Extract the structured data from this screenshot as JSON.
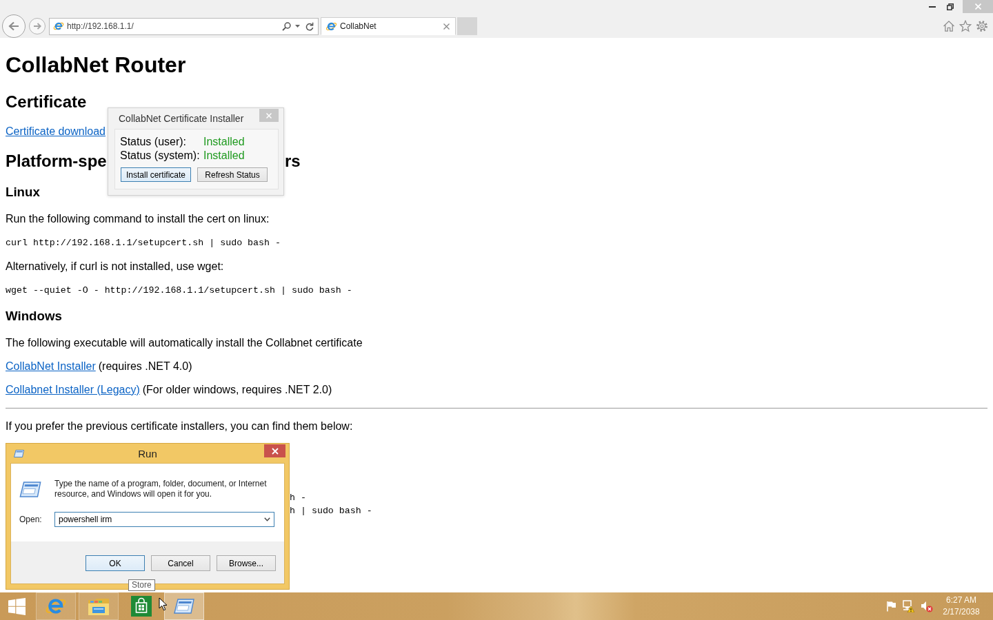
{
  "browser": {
    "address": "http://192.168.1.1/",
    "tabs": [
      {
        "label": "CollabNet",
        "selected": true
      }
    ]
  },
  "page": {
    "blocks": [
      {
        "kind": "title",
        "text": "CollabNet Router"
      },
      {
        "kind": "heading",
        "text": "Certificate"
      },
      {
        "kind": "link_line",
        "link": "Certificate download"
      },
      {
        "kind": "obscured_heading",
        "fragments": [
          "Platform-spe",
          "rs"
        ]
      },
      {
        "kind": "subheading",
        "text": "Linux"
      },
      {
        "kind": "paragraph",
        "text": "Run the following command to install the cert on linux:"
      },
      {
        "kind": "code",
        "text": "curl http://192.168.1.1/setupcert.sh | sudo bash -"
      },
      {
        "kind": "paragraph",
        "text": "Alternatively, if curl is not installed, use wget:"
      },
      {
        "kind": "code",
        "text": "wget --quiet -O - http://192.168.1.1/setupcert.sh | sudo bash -"
      },
      {
        "kind": "subheading",
        "text": "Windows"
      },
      {
        "kind": "paragraph",
        "text": "The following executable will automatically install the Collabnet certificate"
      },
      {
        "kind": "link_line",
        "link": "CollabNet Installer",
        "note": "(requires .NET 4.0)"
      },
      {
        "kind": "link_line",
        "link": "Collabnet Installer (Legacy)",
        "note": "(For older windows, requires .NET 2.0)"
      },
      {
        "kind": "rule"
      },
      {
        "kind": "paragraph",
        "text": "If you prefer the previous certificate installers, you can find them below:"
      },
      {
        "kind": "obscured_code",
        "fragments": [
          "h -",
          "h | sudo bash -"
        ]
      }
    ]
  },
  "installer_popup": {
    "title": "CollabNet Certificate Installer",
    "statuses": [
      {
        "label": "Status (user):",
        "value": "Installed"
      },
      {
        "label": "Status (system):",
        "value": "Installed"
      }
    ],
    "buttons": [
      {
        "label": "Install certificate",
        "focused": true
      },
      {
        "label": "Refresh Status",
        "focused": false
      }
    ]
  },
  "run_dialog": {
    "title": "Run",
    "description": "Type the name of a program, folder, document, or Internet resource, and Windows will open it for you.",
    "open_label": "Open:",
    "value": "powershell irm",
    "buttons": [
      {
        "label": "OK",
        "focused": true
      },
      {
        "label": "Cancel",
        "focused": false
      },
      {
        "label": "Browse...",
        "focused": false
      }
    ]
  },
  "tooltip": "Store",
  "taskbar": {
    "apps": [
      {
        "kind": "browser",
        "running": true,
        "selected": false
      },
      {
        "kind": "file_explorer",
        "running": true,
        "selected": false
      },
      {
        "kind": "store",
        "running": false,
        "selected": false
      },
      {
        "kind": "run",
        "running": true,
        "selected": true
      }
    ],
    "tray": {
      "network_warning": true,
      "muted": true,
      "time": "6:27 AM",
      "date": "2/17/2038"
    }
  }
}
